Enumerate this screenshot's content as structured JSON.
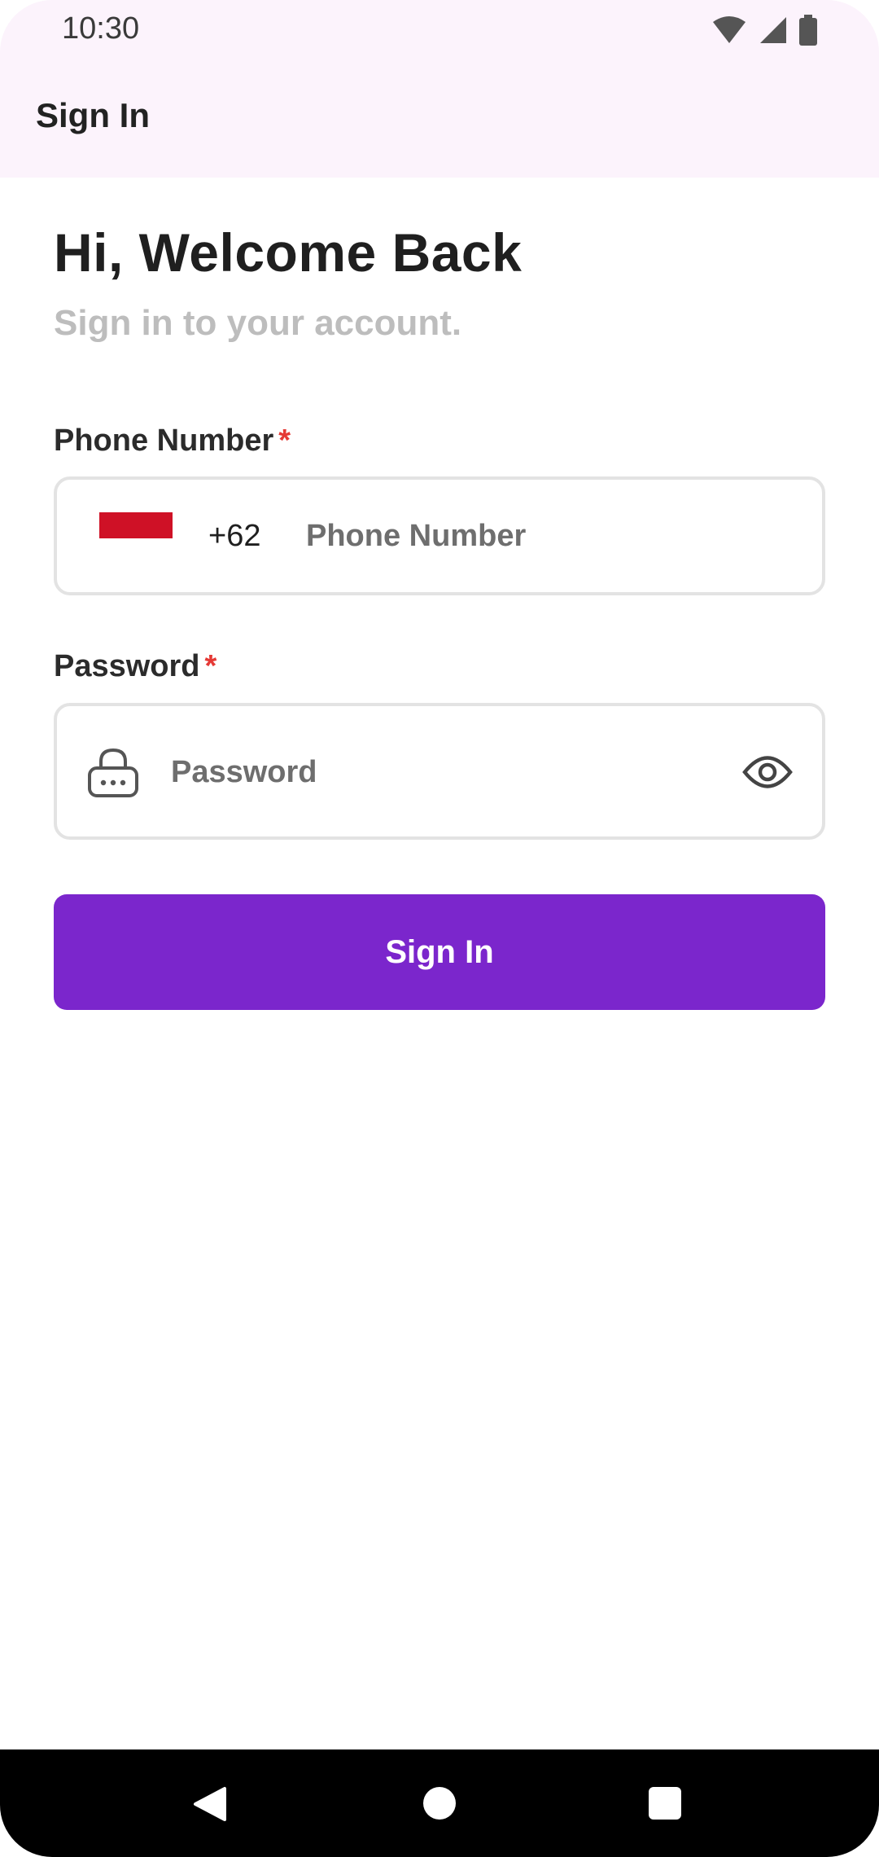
{
  "status_bar": {
    "time": "10:30"
  },
  "app_bar": {
    "title": "Sign In"
  },
  "header": {
    "headline": "Hi, Welcome Back",
    "subtitle": "Sign in to your account."
  },
  "phone": {
    "label": "Phone Number",
    "required_mark": "*",
    "country_code": "+62",
    "placeholder": "Phone Number",
    "value": "",
    "flag_icon": "indonesia-flag-icon"
  },
  "password": {
    "label": "Password",
    "required_mark": "*",
    "placeholder": "Password",
    "value": "",
    "leading_icon": "lock-icon",
    "trailing_icon": "eye-icon"
  },
  "actions": {
    "sign_in_label": "Sign In"
  },
  "colors": {
    "primary": "#7b26cc",
    "required": "#e53935",
    "top_bar_bg": "#fcf3fc"
  }
}
